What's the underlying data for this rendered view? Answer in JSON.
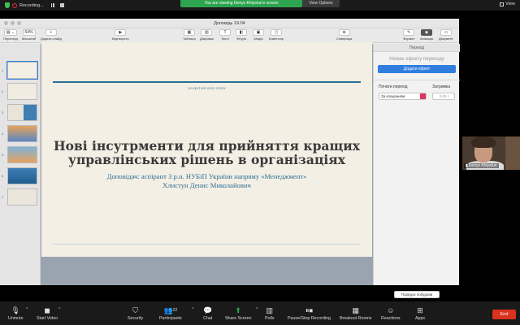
{
  "zoom_top": {
    "recording_label": "Recording...",
    "share_banner": "You are viewing Denys Khlystun's screen",
    "view_options": "View Options",
    "view_label": "View"
  },
  "keynote": {
    "window_title": "Доповідь 19.04",
    "toolbar": {
      "view": "Перегляд",
      "zoom_value": "64%",
      "zoom_label": "Масштаб",
      "add_slide": "Додати слайд",
      "play": "Відтворити",
      "table": "Таблиця",
      "chart": "Діаграма",
      "text": "Текст",
      "shape": "Фігура",
      "media": "Медіа",
      "comment": "Коментар",
      "share": "Співпраця",
      "format": "Формат",
      "animate": "Анімація",
      "document": "Документ"
    },
    "slide_numbers": [
      "1",
      "2",
      "3",
      "4",
      "5",
      "6",
      "7"
    ],
    "slide": {
      "date": "19 КВІТНЯ 2022 РОКУ",
      "title_line1": "Нові інсутрменти для прийняття кращих",
      "title_line2": "управлінських рішень в організаціях",
      "speaker_line1": "Доповідач: аспірант 3 р.н. НУБіП України напряму «Менеджмент»",
      "speaker_line2": "Хлистун Денис Миколайович"
    },
    "inspector": {
      "tab": "Перехід",
      "no_effect": "Немає ефекту переходу",
      "add_effect": "Додати ефект",
      "start_label": "Почати перехід",
      "start_value": "За клацанням",
      "delay_label": "Затримка",
      "delay_value": "0,00 с",
      "build_order": "Порядок побудови"
    }
  },
  "participant": {
    "name": "Denys Khlystun"
  },
  "zoom_bottom": {
    "unmute": "Unmute",
    "start_video": "Start Video",
    "security": "Security",
    "participants": "Participants",
    "participants_count": "22",
    "chat": "Chat",
    "share_screen": "Share Screen",
    "polls": "Polls",
    "recording": "Pause/Stop Recording",
    "breakout": "Breakout Rooms",
    "reactions": "Reactions",
    "apps": "Apps",
    "end": "End"
  },
  "colors": {
    "accent_blue": "#2a6f96",
    "share_green": "#2da44e",
    "end_red": "#d9321f"
  }
}
